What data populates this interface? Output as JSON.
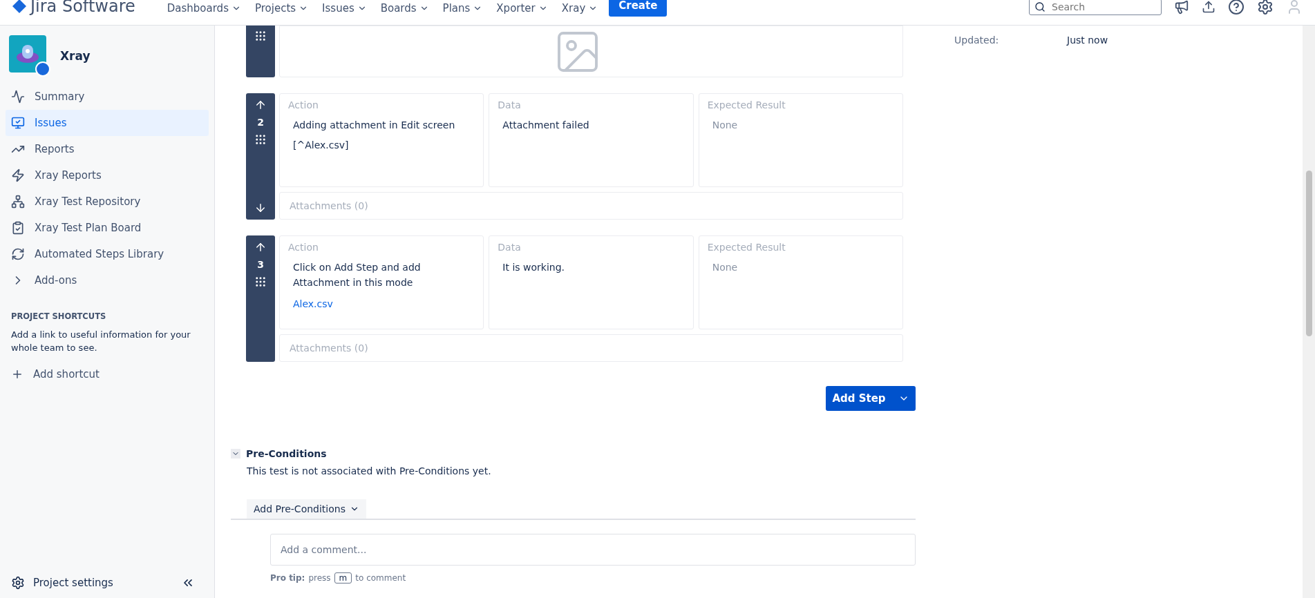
{
  "header": {
    "logo": "Jira Software",
    "nav": [
      {
        "label": "Dashboards"
      },
      {
        "label": "Projects"
      },
      {
        "label": "Issues"
      },
      {
        "label": "Boards"
      },
      {
        "label": "Plans"
      },
      {
        "label": "Xporter"
      },
      {
        "label": "Xray"
      }
    ],
    "create": "Create",
    "search": {
      "placeholder": "Search"
    }
  },
  "sidebar": {
    "project": "Xray",
    "items": [
      {
        "label": "Summary",
        "selected": false
      },
      {
        "label": "Issues",
        "selected": true
      },
      {
        "label": "Reports",
        "selected": false
      },
      {
        "label": "Xray Reports",
        "selected": false
      },
      {
        "label": "Xray Test Repository",
        "selected": false
      },
      {
        "label": "Xray Test Plan Board",
        "selected": false
      },
      {
        "label": "Automated Steps Library",
        "selected": false
      },
      {
        "label": "Add-ons",
        "selected": false
      }
    ],
    "shortcuts_heading": "PROJECT SHORTCUTS",
    "shortcuts_text": "Add a link to useful information for your whole team to see.",
    "add_shortcut": "Add shortcut",
    "settings": "Project settings"
  },
  "steps": [
    {
      "number": "2",
      "can_move_down": true,
      "action_label": "Action",
      "action": "Adding attachment in Edit screen",
      "attachment": {
        "text": "[^Alex.csv]",
        "kind": "plain"
      },
      "data_label": "Data",
      "data": "Attachment failed",
      "expected_label": "Expected Result",
      "expected": "None",
      "expected_empty": true,
      "attachments": "Attachments (0)"
    },
    {
      "number": "3",
      "can_move_down": false,
      "action_label": "Action",
      "action": "Click on Add Step and add Attachment in this mode",
      "attachment": {
        "text": "Alex.csv",
        "kind": "link"
      },
      "data_label": "Data",
      "data": "It is working.",
      "expected_label": "Expected Result",
      "expected": "None",
      "expected_empty": true,
      "attachments": "Attachments (0)"
    }
  ],
  "add_step": "Add Step",
  "preconditions": {
    "title": "Pre-Conditions",
    "expanded": true,
    "text": "This test is not associated with Pre-Conditions yet.",
    "add_button": "Add Pre-Conditions"
  },
  "comment": {
    "placeholder": "Add a comment...",
    "tip_label": "Pro tip:",
    "tip_press": "press",
    "tip_key": "m",
    "tip_rest": "to comment"
  },
  "details": {
    "label": "Updated:",
    "value": "Just now"
  }
}
